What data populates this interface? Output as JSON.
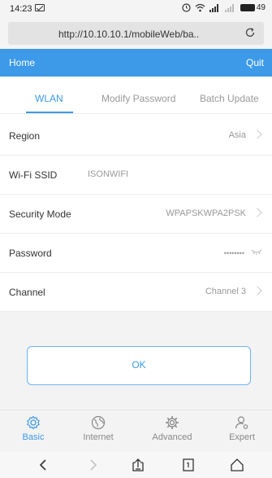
{
  "status_bar": {
    "time": "14:23",
    "battery": "49",
    "icons": [
      "message-icon",
      "alarm-icon",
      "wifi-icon",
      "signal-icon",
      "signal-icon",
      "battery-icon"
    ]
  },
  "browser": {
    "url": "http://10.10.10.1/mobileWeb/ba.."
  },
  "header": {
    "home": "Home",
    "quit": "Quit",
    "accent_color": "#3d9ae8"
  },
  "tabs": [
    {
      "label": "WLAN",
      "active": true
    },
    {
      "label": "Modify Password",
      "active": false
    },
    {
      "label": "Batch Update",
      "active": false
    }
  ],
  "settings": {
    "region": {
      "label": "Region",
      "value": "Asia"
    },
    "ssid": {
      "label": "Wi-Fi SSID",
      "value": "ISONWIFI"
    },
    "security": {
      "label": "Security Mode",
      "value": "WPAPSKWPA2PSK"
    },
    "password": {
      "label": "Password",
      "value": "••••••••"
    },
    "channel": {
      "label": "Channel",
      "value": "Channel 3"
    }
  },
  "ok_button": {
    "label": "OK"
  },
  "bottom_nav": [
    {
      "label": "Basic",
      "icon": "gear-icon",
      "active": true
    },
    {
      "label": "Internet",
      "icon": "globe-icon",
      "active": false
    },
    {
      "label": "Advanced",
      "icon": "advanced-gear-icon",
      "active": false
    },
    {
      "label": "Expert",
      "icon": "user-settings-icon",
      "active": false
    }
  ]
}
